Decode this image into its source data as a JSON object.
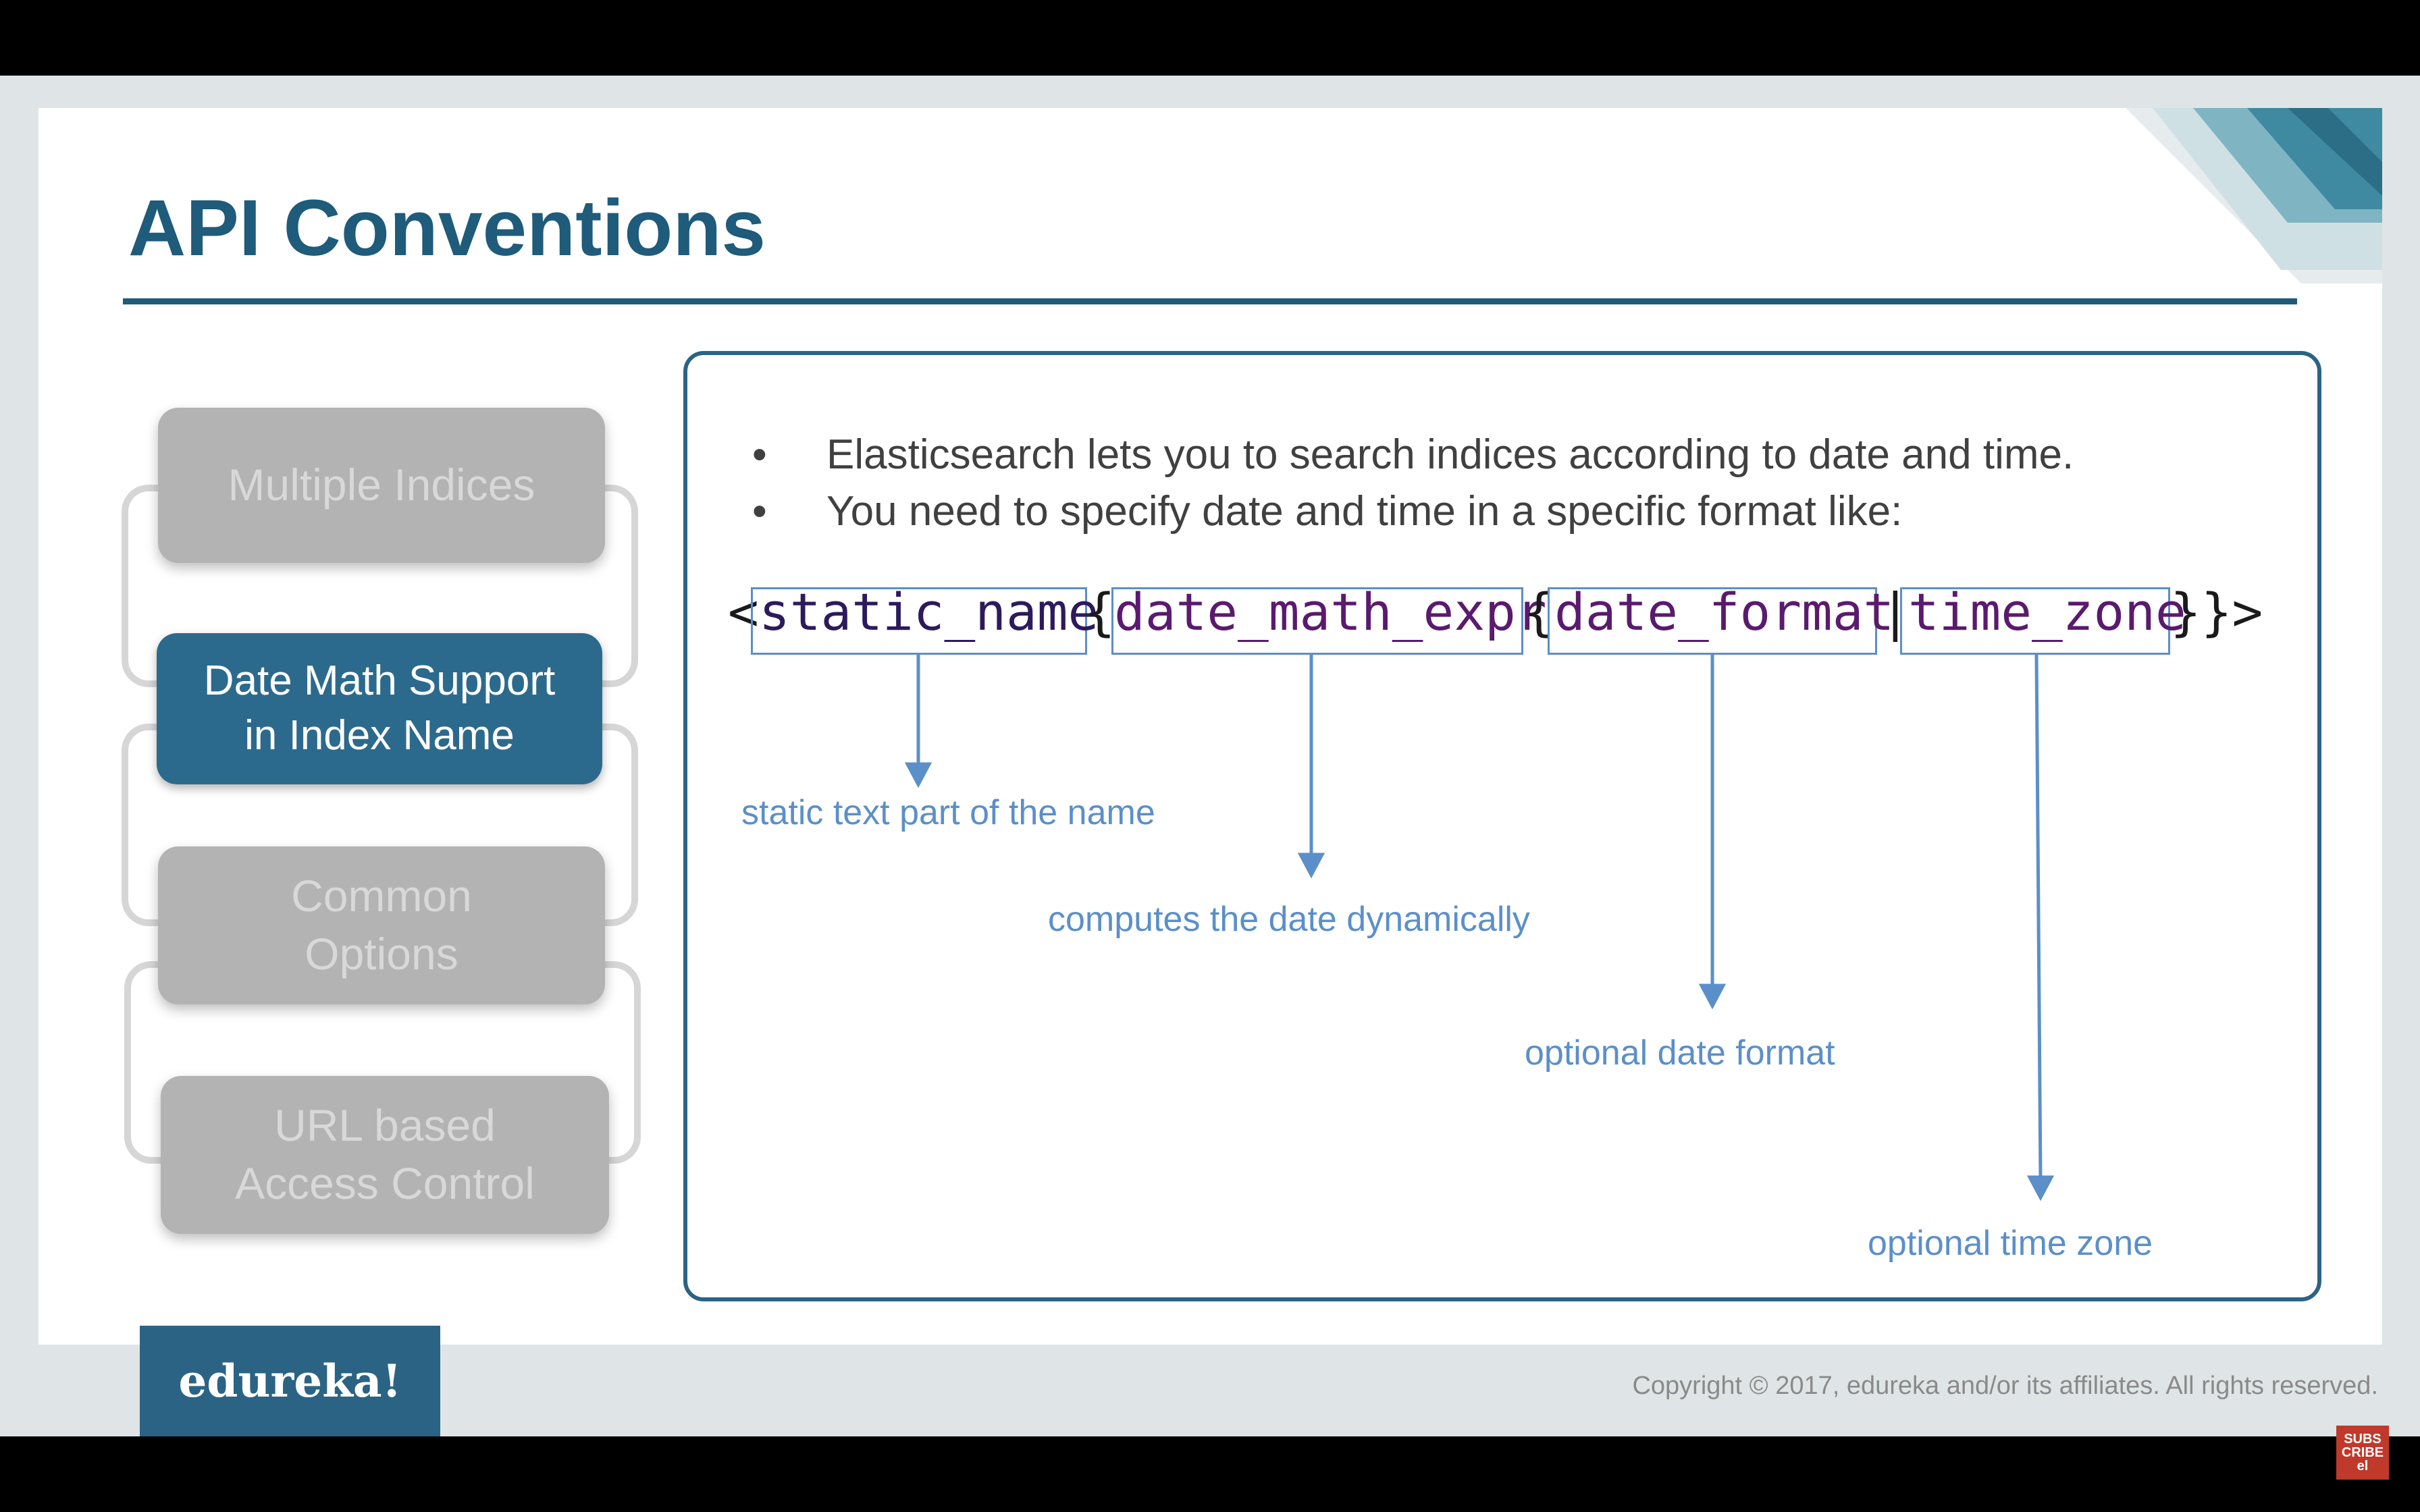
{
  "slide": {
    "title": "API Conventions",
    "nav": [
      {
        "label": "Multiple Indices",
        "active": false
      },
      {
        "label": "Date Math Support\nin Index Name",
        "active": true
      },
      {
        "label": "Common\nOptions",
        "active": false
      },
      {
        "label": "URL based\nAccess Control",
        "active": false
      }
    ],
    "bullets": [
      "Elasticsearch lets you to search indices according to date and time.",
      "You need to specify date and time in a specific format like:"
    ],
    "bullet_glyph": "•",
    "syntax": {
      "open": "<",
      "static_name": "static_name",
      "brace1": "{",
      "date_math_expr": "date_math_expr",
      "brace2": "{",
      "date_format": "date_format",
      "pipe": "|",
      "time_zone": "time_zone",
      "close": "}}>"
    },
    "notes": {
      "static": "static text part of the name",
      "date_math": "computes the date dynamically",
      "date_format": "optional date format",
      "time_zone": "optional time zone"
    },
    "logo": "edureka!",
    "copyright": "Copyright © 2017, edureka and/or its affiliates. All rights reserved.",
    "subscribe_badge": [
      "SUBS",
      "CRIBE",
      "el"
    ]
  },
  "colors": {
    "title": "#1f5b7a",
    "active_nav": "#2c6a8d",
    "inactive_nav": "#b3b3b3",
    "annotation": "#5b8fc9",
    "panel_border": "#2b6384"
  }
}
